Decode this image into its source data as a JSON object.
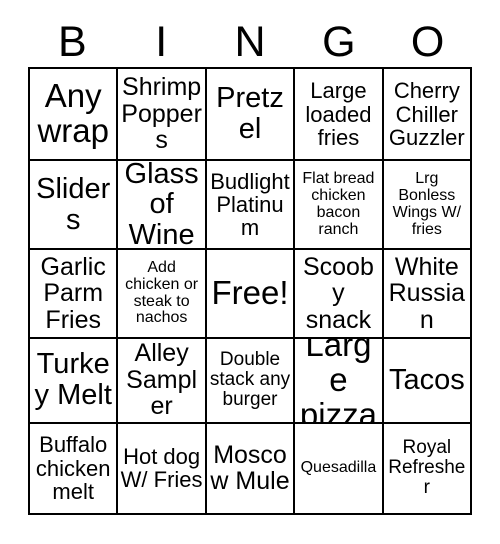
{
  "card": {
    "title": "BINGO",
    "header_letters": [
      "B",
      "I",
      "N",
      "G",
      "O"
    ],
    "free_space_label": "Free!",
    "border_color": "#000000",
    "background_color": "#ffffff",
    "text_color": "#000000",
    "columns": 5,
    "rows": 5,
    "cells": [
      [
        {
          "text": "Any wrap",
          "size": "fs-xxl"
        },
        {
          "text": "Shrimp Poppers",
          "size": "fs-lg"
        },
        {
          "text": "Pretzel",
          "size": "fs-xl"
        },
        {
          "text": "Large loaded fries",
          "size": "fs-md"
        },
        {
          "text": "Cherry Chiller Guzzler",
          "size": "fs-md"
        }
      ],
      [
        {
          "text": "Sliders",
          "size": "fs-xl"
        },
        {
          "text": "Glass of Wine",
          "size": "fs-xl"
        },
        {
          "text": "Budlight Platinum",
          "size": "fs-md"
        },
        {
          "text": "Flat bread chicken bacon ranch",
          "size": "fs-xs"
        },
        {
          "text": "Lrg Bonless Wings W/ fries",
          "size": "fs-xs"
        }
      ],
      [
        {
          "text": "Garlic Parm Fries",
          "size": "fs-lg"
        },
        {
          "text": "Add chicken or steak to nachos",
          "size": "fs-xs"
        },
        {
          "text": "Free!",
          "size": "fs-xxl"
        },
        {
          "text": "Scooby snack",
          "size": "fs-lg"
        },
        {
          "text": "White Russian",
          "size": "fs-lg"
        }
      ],
      [
        {
          "text": "Turkey Melt",
          "size": "fs-xl"
        },
        {
          "text": "Alley Sampler",
          "size": "fs-lg"
        },
        {
          "text": "Double stack any burger",
          "size": "fs-sm"
        },
        {
          "text": "Large pizza",
          "size": "fs-xxl"
        },
        {
          "text": "Tacos",
          "size": "fs-xl"
        }
      ],
      [
        {
          "text": "Buffalo chicken melt",
          "size": "fs-md"
        },
        {
          "text": "Hot dog W/ Fries",
          "size": "fs-md"
        },
        {
          "text": "Moscow Mule",
          "size": "fs-lg"
        },
        {
          "text": "Quesadilla",
          "size": "fs-xs"
        },
        {
          "text": "Royal Refresher",
          "size": "fs-sm"
        }
      ]
    ]
  }
}
